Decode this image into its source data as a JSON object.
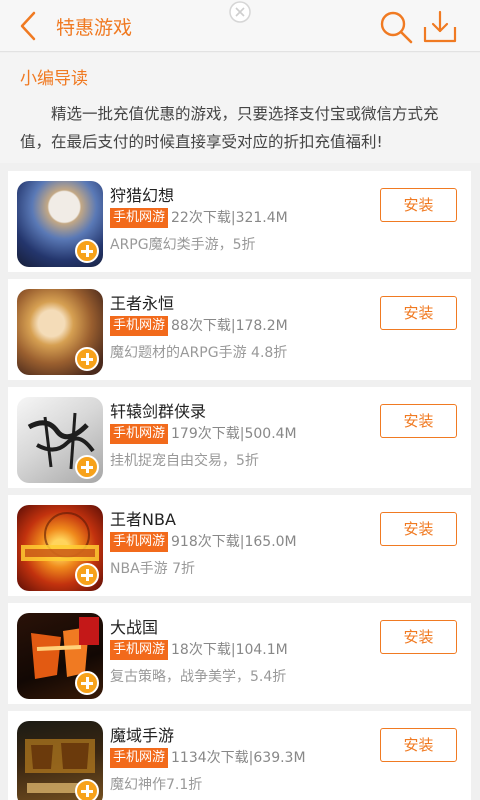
{
  "header": {
    "title": "特惠游戏"
  },
  "intro": {
    "title": "小编导读",
    "text": "精选一批充值优惠的游戏，只要选择支付宝或微信方式充值，在最后支付的时候直接享受对应的折扣充值福利!"
  },
  "colors": {
    "accent": "#f07a22",
    "tag_bg": "#f26a1b",
    "background": "#f0f0f0"
  },
  "games": [
    {
      "name": "狩猎幻想",
      "tag": "手机网游",
      "downloads": "22次下载",
      "size": "321.4M",
      "desc": "ARPG魔幻类手游，5折",
      "button": "安装"
    },
    {
      "name": "王者永恒",
      "tag": "手机网游",
      "downloads": "88次下载",
      "size": "178.2M",
      "desc": "魔幻题材的ARPG手游 4.8折",
      "button": "安装"
    },
    {
      "name": "轩辕剑群侠录",
      "tag": "手机网游",
      "downloads": "179次下载",
      "size": "500.4M",
      "desc": "挂机捉宠自由交易，5折",
      "button": "安装"
    },
    {
      "name": "王者NBA",
      "tag": "手机网游",
      "downloads": "918次下载",
      "size": "165.0M",
      "desc": "NBA手游 7折",
      "button": "安装"
    },
    {
      "name": "大战国",
      "tag": "手机网游",
      "downloads": "18次下载",
      "size": "104.1M",
      "desc": "复古策略，战争美学，5.4折",
      "button": "安装"
    },
    {
      "name": "魔域手游",
      "tag": "手机网游",
      "downloads": "1134次下载",
      "size": "639.3M",
      "desc": "魔幻神作7.1折",
      "button": "安装"
    }
  ]
}
